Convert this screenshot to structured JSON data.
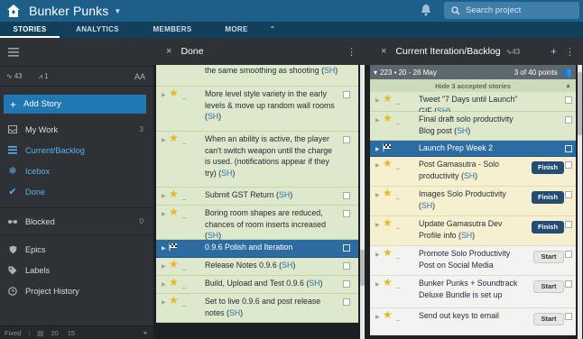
{
  "header": {
    "project_name": "Bunker Punks",
    "search_placeholder": "Search project"
  },
  "nav_tabs": [
    {
      "label": "STORIES"
    },
    {
      "label": "ANALYTICS"
    },
    {
      "label": "MEMBERS"
    },
    {
      "label": "MORE"
    }
  ],
  "sidebar": {
    "velocity": "43",
    "volatility": "1",
    "text_size_label": "AA",
    "add_story": "Add Story",
    "items": [
      {
        "label": "My Work",
        "count": "3"
      },
      {
        "label": "Current/Backlog",
        "count": ""
      },
      {
        "label": "Icebox",
        "count": ""
      },
      {
        "label": "Done",
        "count": ""
      },
      {
        "label": "Blocked",
        "count": "0"
      },
      {
        "label": "Epics",
        "count": ""
      },
      {
        "label": "Labels",
        "count": ""
      },
      {
        "label": "Project History",
        "count": ""
      }
    ],
    "footer_label": "Fixed",
    "footer_counts": [
      "20",
      "15"
    ]
  },
  "done_panel": {
    "title": "Done",
    "stories": [
      {
        "text": "the same smoothing as shooting",
        "owner": "SH",
        "type": "feature"
      },
      {
        "text": "More level style variety in the early levels & move up random wall rooms",
        "owner": "SH",
        "type": "feature"
      },
      {
        "text": "When an ability is active, the player can't switch weapon until the charge is used. (notifications appear if they try)",
        "owner": "SH",
        "type": "feature"
      },
      {
        "text": "Submit GST Return",
        "owner": "SH",
        "type": "feature"
      },
      {
        "text": "Boring room shapes are reduced, chances of room inserts increased",
        "owner": "SH",
        "type": "feature"
      },
      {
        "text": "0.9.6 Polish and Iteration",
        "owner": "",
        "type": "release"
      },
      {
        "text": "Release Notes 0.9.6",
        "owner": "SH",
        "type": "feature"
      },
      {
        "text": "Build, Upload and Test 0.9.6",
        "owner": "SH",
        "type": "feature"
      },
      {
        "text": "Set to live 0.9.6 and post release notes",
        "owner": "SH",
        "type": "feature"
      }
    ]
  },
  "current_panel": {
    "title": "Current Iteration/Backlog",
    "velocity": "43",
    "iteration_label": "223 • 20 - 26 May",
    "points": "3 of 40 points",
    "hide_accepted": "Hide 3 accepted stories",
    "stories": [
      {
        "text": "Tweet \"7 Days until Launch\" GIF",
        "owner": "SH",
        "state": "accepted",
        "button": ""
      },
      {
        "text": "Final draft solo productivity Blog post",
        "owner": "SH",
        "state": "accepted",
        "button": ""
      },
      {
        "text": "Launch Prep Week 2",
        "owner": "",
        "state": "release",
        "button": ""
      },
      {
        "text": "Post Gamasutra - Solo productivity",
        "owner": "SH",
        "state": "started",
        "button": "Finish"
      },
      {
        "text": "Images Solo Productivity",
        "owner": "SH",
        "state": "started",
        "button": "Finish"
      },
      {
        "text": "Update Gamasutra Dev Profile info",
        "owner": "SH",
        "state": "started",
        "button": "Finish"
      },
      {
        "text": "Promote Solo Productivity Post on Social Media",
        "owner": "",
        "state": "unstarted",
        "button": "Start"
      },
      {
        "text": "Bunker Punks + Soundtrack Deluxe Bundle is set up",
        "owner": "",
        "state": "unstarted",
        "button": "Start"
      },
      {
        "text": "Send out keys to email",
        "owner": "",
        "state": "unstarted",
        "button": "Start"
      }
    ]
  },
  "colors": {
    "header": "#1e5f8a",
    "tabs": "#123f5c",
    "accepted": "#dde8cc",
    "started": "#f6f0d0",
    "release": "#2c6ca0",
    "finish_button": "#244d73"
  }
}
